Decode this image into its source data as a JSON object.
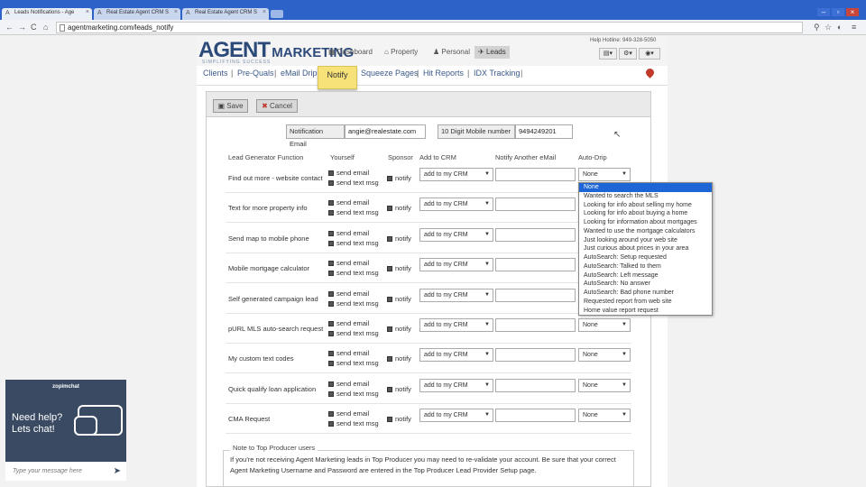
{
  "browser": {
    "tabs": [
      "Leads Notifications - Age",
      "Real Estate Agent CRM S",
      "Real Estate Agent CRM S"
    ],
    "url": "agentmarketing.com/leads_notify"
  },
  "header": {
    "logo_main": "AGENT",
    "logo_sub": "MARKETING",
    "logo_tag": "SIMPLIFYING SUCCESS",
    "nav": [
      "Dashboard",
      "Property",
      "Personal",
      "Leads"
    ],
    "hotline": "Help Hotline: 949-328-5050"
  },
  "subnav": [
    "Clients",
    "Pre-Quals",
    "eMail Drip",
    "Notify",
    "Squeeze Pages",
    "Hit Reports",
    "IDX Tracking"
  ],
  "toolbar": {
    "save": "Save",
    "cancel": "Cancel"
  },
  "contact": {
    "email_label": "Notification Email",
    "email_value": "angie@realestate.com",
    "mobile_label": "10 Digit Mobile number",
    "mobile_value": "9494249201"
  },
  "columns": [
    "Lead Generator Function",
    "Yourself",
    "Sponsor",
    "Add to CRM",
    "Notify Another eMail",
    "Auto-Drip"
  ],
  "options": {
    "send_email": "send email",
    "send_text": "send text msg",
    "notify": "notify"
  },
  "rows": [
    {
      "name": "Find out more - website contact",
      "crm": "add to my CRM",
      "drip": "None"
    },
    {
      "name": "Text for more property info",
      "crm": "add to my CRM",
      "drip": "None"
    },
    {
      "name": "Send map to mobile phone",
      "crm": "add to my CRM",
      "drip": "None"
    },
    {
      "name": "Mobile mortgage calculator",
      "crm": "add to my CRM",
      "drip": "None"
    },
    {
      "name": "Self generated campaign lead",
      "crm": "add to my CRM",
      "drip": "None"
    },
    {
      "name": "pURL MLS auto-search request",
      "crm": "add to my CRM",
      "drip": "None"
    },
    {
      "name": "My custom text codes",
      "crm": "add to my CRM",
      "drip": "None"
    },
    {
      "name": "Quick qualify loan application",
      "crm": "add to my CRM",
      "drip": "None"
    },
    {
      "name": "CMA Request",
      "crm": "add to my CRM",
      "drip": "None"
    }
  ],
  "dropdown": [
    "None",
    "Wanted to search the MLS",
    "Looking for info about selling my home",
    "Looking for info about buying a home",
    "Looking for information about mortgages",
    "Wanted to use the mortgage calculators",
    "Just looking around your web site",
    "Just curious about prices in your area",
    "AutoSearch: Setup requested",
    "AutoSearch: Talked to them",
    "AutoSearch: Left message",
    "AutoSearch: No answer",
    "AutoSearch: Bad phone number",
    "Requested report from web site",
    "Home value report request"
  ],
  "note": {
    "title": "Note to Top Producer users",
    "text": "If you're not receiving Agent Marketing leads in Top Producer you may need to re-validate your account. Be sure that your correct Agent Marketing Username and Password are entered in the Top Producer Lead Provider Setup page."
  },
  "chat": {
    "brand": "zopimchat",
    "help1": "Need help?",
    "help2": "Lets chat!",
    "placeholder": "Type your message here"
  },
  "colors": {
    "tabbar": "#2d63c8",
    "notify_tab": "#f7e27a",
    "dropdown_highlight": "#1e66d6",
    "chat": "#3a4a62"
  }
}
